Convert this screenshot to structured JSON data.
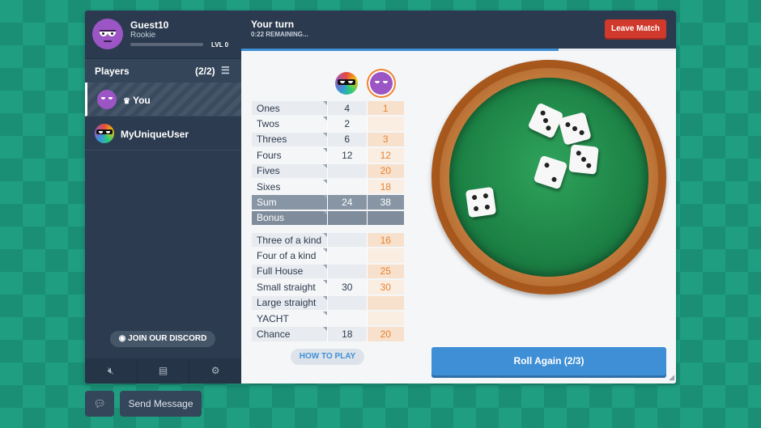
{
  "profile": {
    "name": "Guest10",
    "rank": "Rookie",
    "level": "LVL 0",
    "xp_fraction": 0.0
  },
  "players": {
    "title": "Players",
    "count": "(2/2)",
    "list": [
      {
        "name": "You",
        "crown": "♛",
        "avatar": "purple-avatar"
      },
      {
        "name": "MyUniqueUser",
        "avatar": "rainbow-masked-avatar"
      }
    ]
  },
  "discord_label": "JOIN OUR DISCORD",
  "footer_icons": [
    "mute-icon",
    "newspaper-icon",
    "gear-icon"
  ],
  "topbar": {
    "turn": "Your turn",
    "remaining": "0:22 REMAINING...",
    "leave": "Leave Match",
    "timer_fraction": 0.73
  },
  "scores": {
    "upper": [
      {
        "label": "Ones",
        "p1": "4",
        "p2": "1"
      },
      {
        "label": "Twos",
        "p1": "2",
        "p2": ""
      },
      {
        "label": "Threes",
        "p1": "6",
        "p2": "3"
      },
      {
        "label": "Fours",
        "p1": "12",
        "p2": "12"
      },
      {
        "label": "Fives",
        "p1": "",
        "p2": "20"
      },
      {
        "label": "Sixes",
        "p1": "",
        "p2": "18"
      }
    ],
    "sum": {
      "label": "Sum",
      "p1": "24",
      "p2": "38"
    },
    "bonus": {
      "label": "Bonus",
      "p1": "",
      "p2": ""
    },
    "lower": [
      {
        "label": "Three of a kind",
        "p1": "",
        "p2": "16"
      },
      {
        "label": "Four of a kind",
        "p1": "",
        "p2": ""
      },
      {
        "label": "Full House",
        "p1": "",
        "p2": "25"
      },
      {
        "label": "Small straight",
        "p1": "30",
        "p2": "30"
      },
      {
        "label": "Large straight",
        "p1": "",
        "p2": ""
      },
      {
        "label": "YACHT",
        "p1": "",
        "p2": ""
      },
      {
        "label": "Chance",
        "p1": "18",
        "p2": "20"
      }
    ]
  },
  "how_to_play": "HOW TO PLAY",
  "dice": [
    4,
    3,
    3,
    2,
    3
  ],
  "roll_label": "Roll Again (2/3)",
  "chat": {
    "send": "Send Message"
  },
  "colors": {
    "accent": "#3f8fd6",
    "danger": "#d0392b",
    "highlight": "#e8822f",
    "sidebar": "#2c3b4f"
  }
}
